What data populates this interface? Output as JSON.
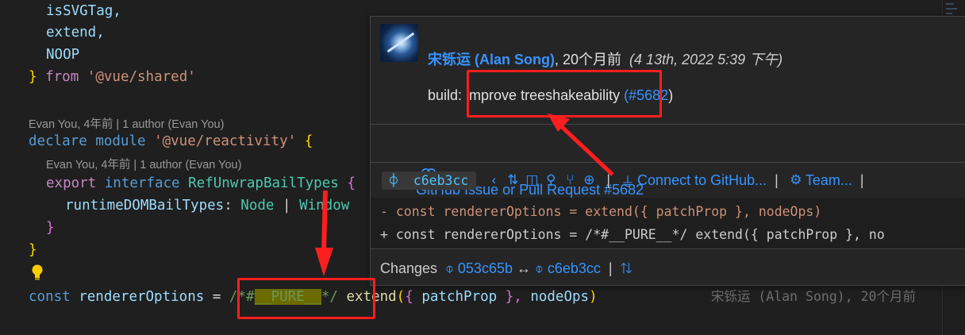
{
  "code": {
    "line_shared_1": "isSVGTag,",
    "line_shared_2": "extend,",
    "line_shared_3": "NOOP",
    "close_brace": "}",
    "from_kw": "from",
    "from_str": "'@vue/shared'",
    "lens_1": "Evan You, 4年前 | 1 author (Evan You)",
    "declare_kw": "declare",
    "module_kw": "module",
    "module_str": "'@vue/reactivity'",
    "open_brace": "{",
    "lens_2": "Evan You, 4年前 | 1 author (Evan You)",
    "export_kw": "export",
    "interface_kw": "interface",
    "iface_name": "RefUnwrapBailTypes",
    "iface_open": "{",
    "prop_name": "runtimeDOMBailTypes",
    "colon": ":",
    "type_node": "Node",
    "bar": "|",
    "type_window": "Window",
    "inner_close": "}",
    "outer_close": "}",
    "const_kw": "const",
    "var_name": "rendererOptions",
    "eq": "=",
    "pure_open": "/*#",
    "pure_mid": "__PURE__",
    "pure_close": "*/",
    "fn_extend": "extend",
    "paren_open": "(",
    "obj_open": "{",
    "patch_prop": "patchProp",
    "obj_close": "},",
    "node_ops": "nodeOps",
    "paren_close": ")",
    "blame_ghost": "宋铄运 (Alan Song), 20个月前"
  },
  "hover": {
    "author_name": "宋铄运 (Alan Song)",
    "author_suffix": ", 20个月前",
    "date": "(4 13th, 2022 5:39 下午)",
    "msg_prefix": "build: ",
    "msg_body": "improve treeshakeability",
    "msg_pr": "(#5682",
    "msg_close": ")",
    "pr_link": "GitHub Issue or Pull Request #5682",
    "sha": "c6eb3cc",
    "connect": "Connect to GitHub...",
    "team": "Team...",
    "diff_del": "- const rendererOptions = extend({ patchProp }, nodeOps)",
    "diff_add": "+ const rendererOptions = /*#__PURE__*/ extend({ patchProp }, no",
    "changes_label": "Changes",
    "changes_from": "053c65b",
    "changes_arrow": "↔",
    "changes_to": "c6eb3cc",
    "changes_pipe": "|"
  },
  "colors": {
    "editor_bg": "#1f1f1f",
    "hover_bg": "#252526",
    "link": "#3794ff",
    "annotation_red": "#ff1e1e"
  }
}
